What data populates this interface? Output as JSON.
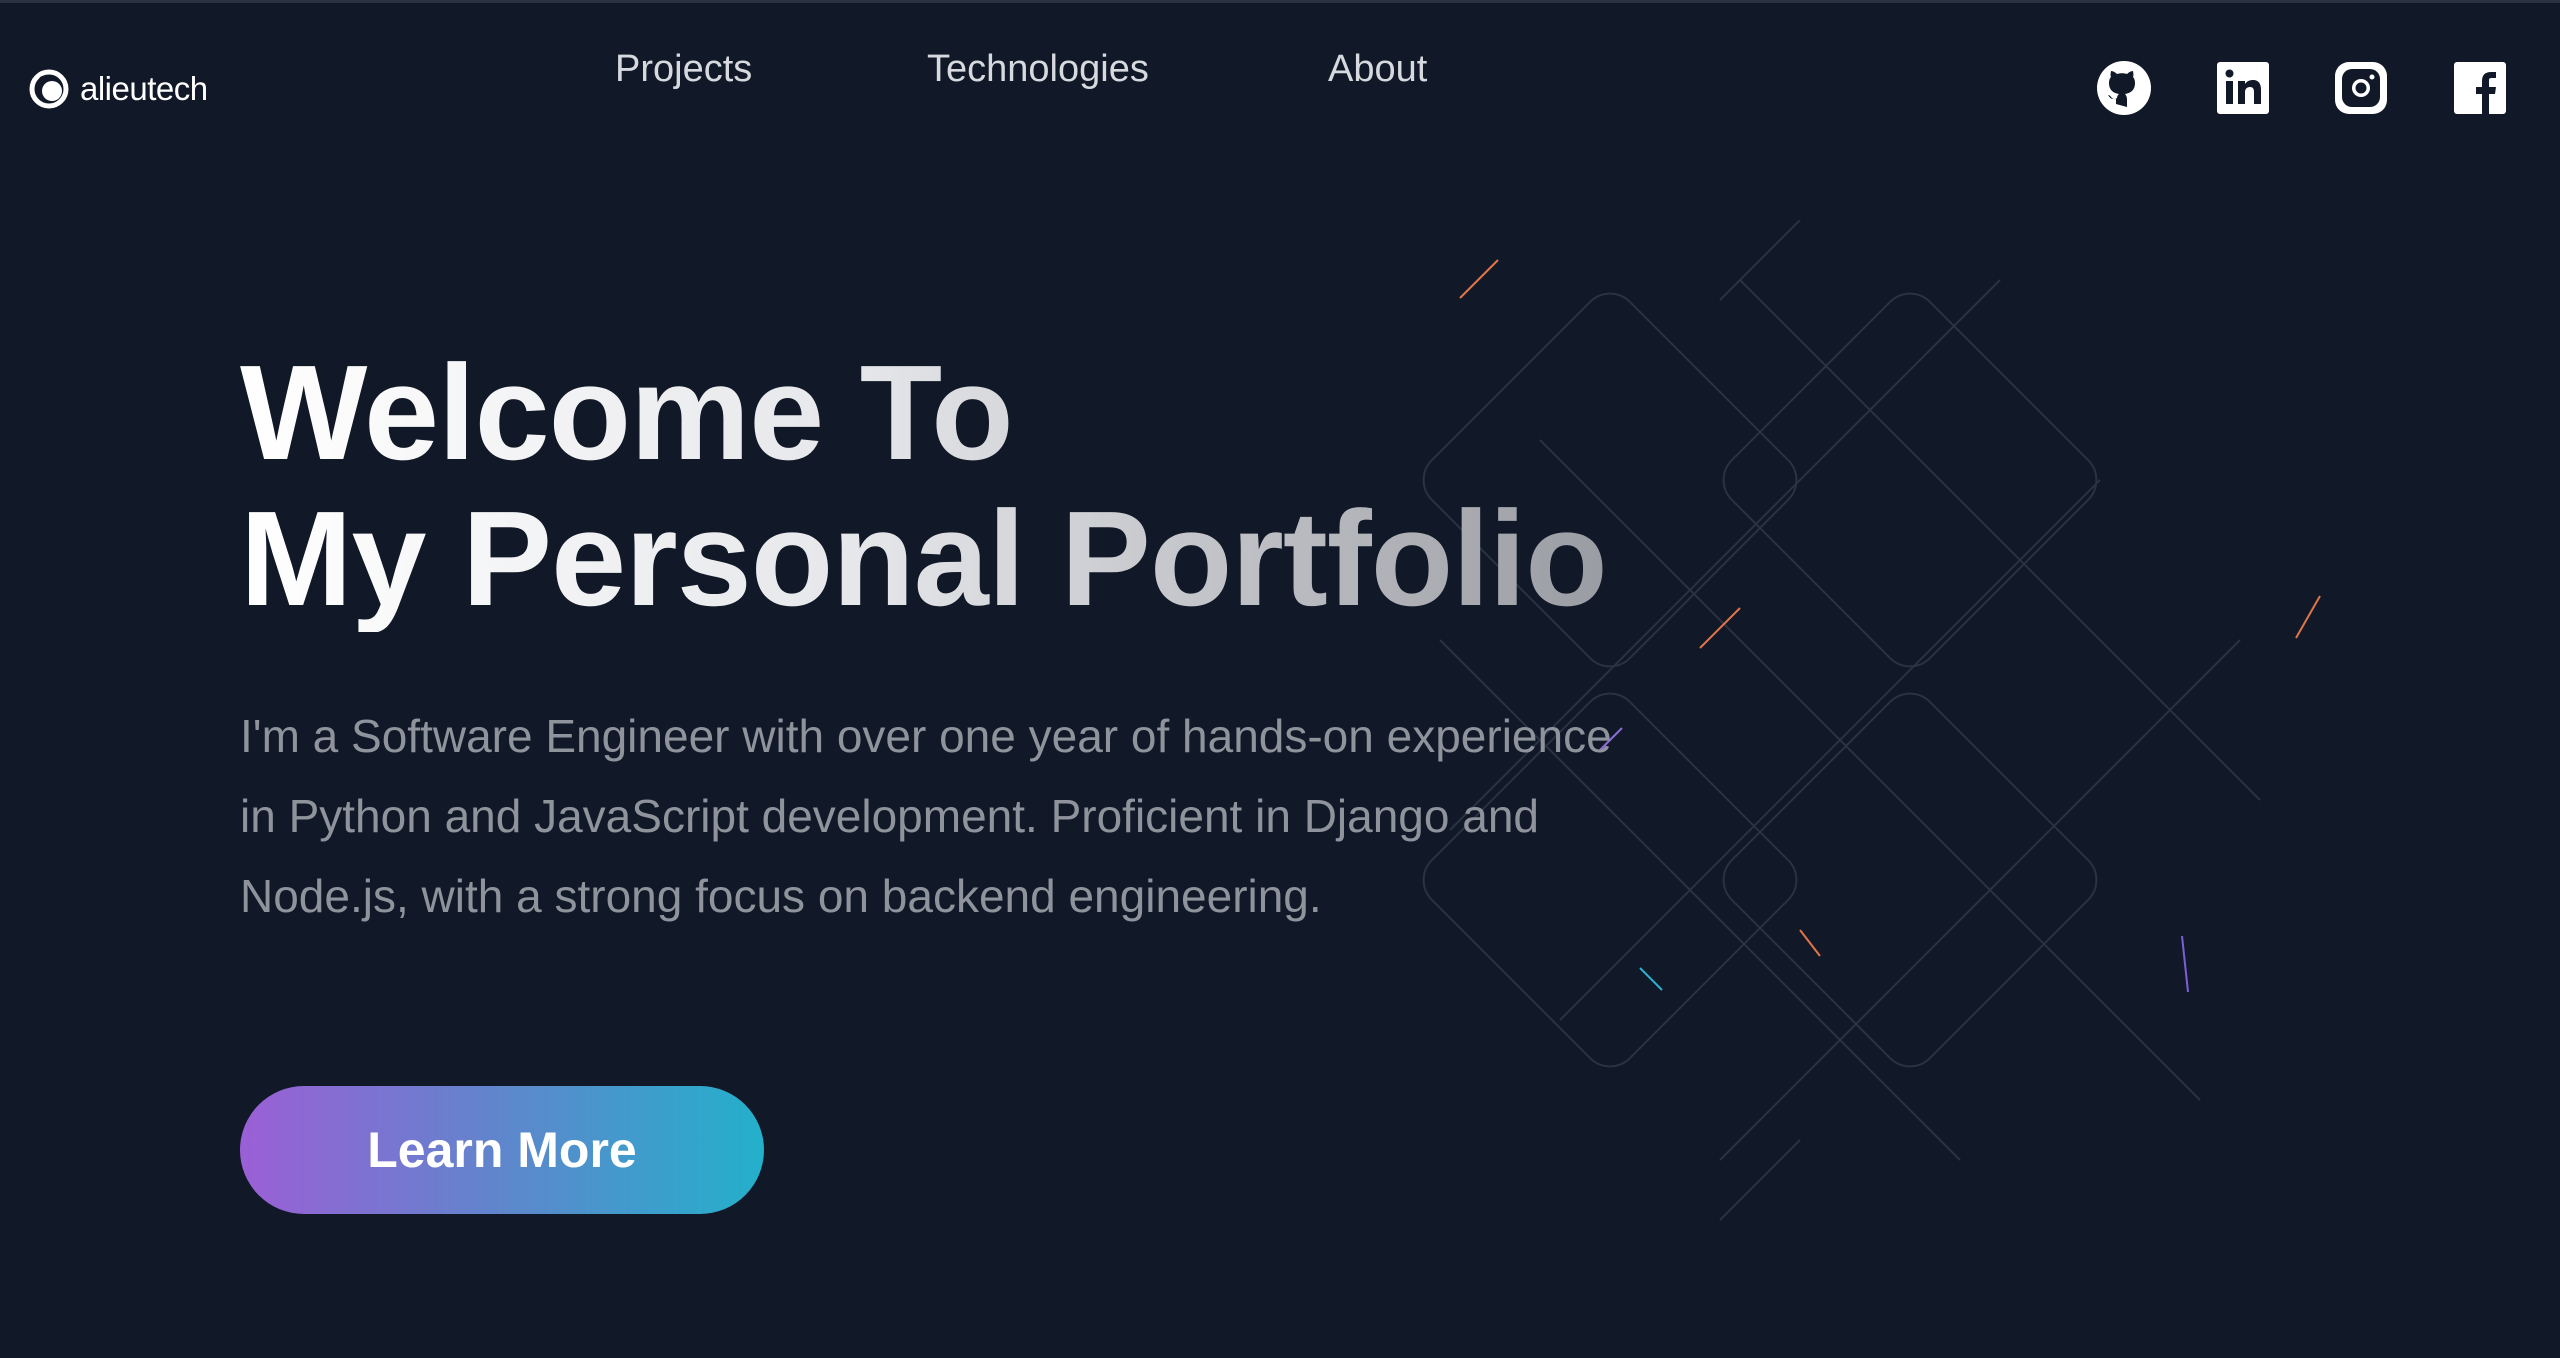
{
  "brand": {
    "name": "alieutech"
  },
  "nav": {
    "links": [
      {
        "label": "Projects"
      },
      {
        "label": "Technologies"
      },
      {
        "label": "About"
      }
    ]
  },
  "socials": [
    {
      "icon": "github-icon"
    },
    {
      "icon": "linkedin-icon"
    },
    {
      "icon": "instagram-icon"
    },
    {
      "icon": "facebook-icon"
    }
  ],
  "hero": {
    "title_line1": "Welcome To",
    "title_line2": "My Personal Portfolio",
    "description": "I'm a Software Engineer with over one year of hands-on experience in Python and JavaScript development. Proficient in Django and Node.js, with a strong focus on backend engineering.",
    "cta_label": "Learn More"
  },
  "colors": {
    "background": "#111827",
    "cta_gradient_start": "#9b5fd6",
    "cta_gradient_end": "#23b0cb",
    "description_text": "#8e939c"
  }
}
